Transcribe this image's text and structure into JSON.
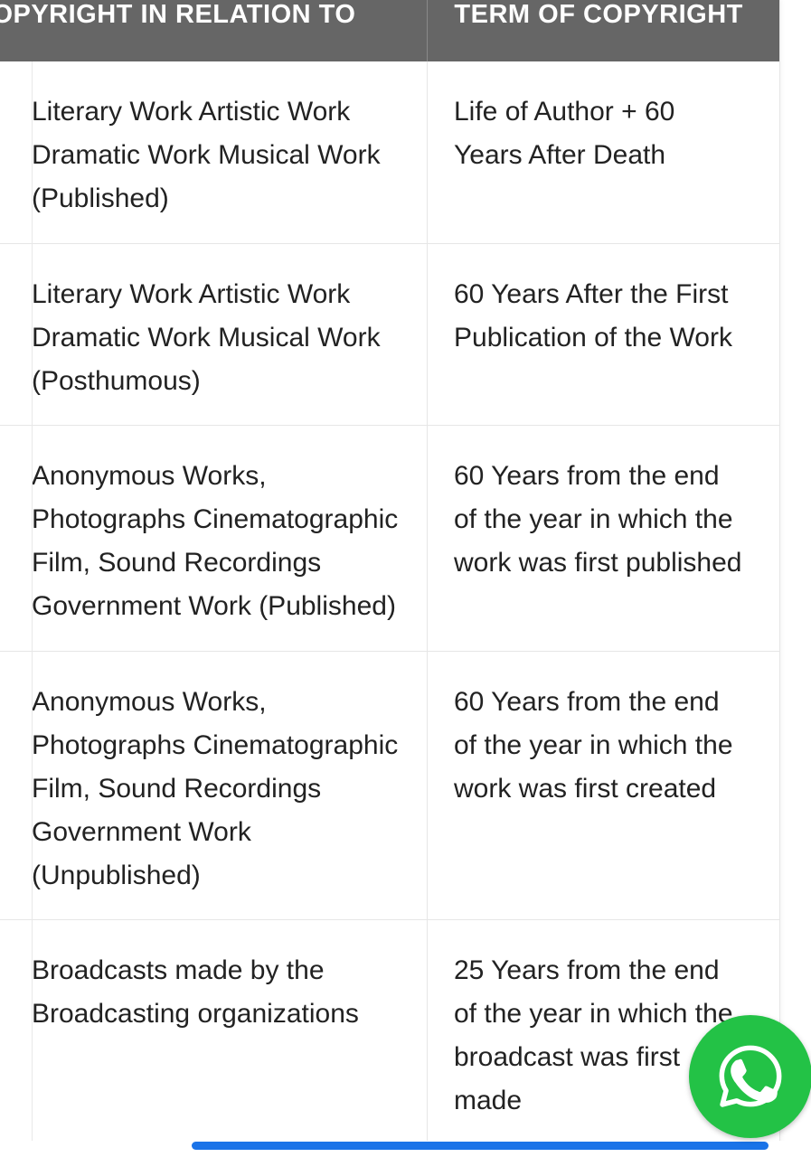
{
  "table": {
    "headers": {
      "col1": "COPYRIGHT IN RELATION TO",
      "col2": "TERM OF COPYRIGHT"
    },
    "rows": [
      {
        "col1_lines": [
          "Literary Work Artistic Work",
          "Dramatic Work Musical Work",
          "(Published)"
        ],
        "col2_lines": [
          "Life of Author + 60",
          "Years After Death"
        ]
      },
      {
        "col1_lines": [
          "Literary Work Artistic Work",
          "Dramatic Work Musical Work",
          "(Posthumous)"
        ],
        "col2_lines": [
          "60 Years After the First",
          "Publication of the Work"
        ]
      },
      {
        "col1_lines": [
          "Anonymous Works,",
          "Photographs Cinematographic",
          "Film, Sound Recordings",
          "Government Work (Published)"
        ],
        "col2_lines": [
          "60 Years from the end",
          "of the year in which the",
          "work was first published"
        ]
      },
      {
        "col1_lines": [
          "Anonymous Works,",
          "Photographs Cinematographic",
          "Film, Sound Recordings",
          "Government Work",
          "(Unpublished)"
        ],
        "col2_lines": [
          "60 Years from the end",
          "of the year in which the",
          "work was first created"
        ]
      },
      {
        "col1_lines": [
          "Broadcasts made by the",
          "Broadcasting organizations"
        ],
        "col2_lines": [
          "25 Years from the end",
          "of the year in which the",
          "broadcast was first",
          "made"
        ]
      }
    ]
  },
  "whatsapp": {
    "icon": "whatsapp-icon",
    "color": "#23c246"
  },
  "colors": {
    "header_bg": "#666666",
    "scroll_thumb": "#1a73e8"
  }
}
